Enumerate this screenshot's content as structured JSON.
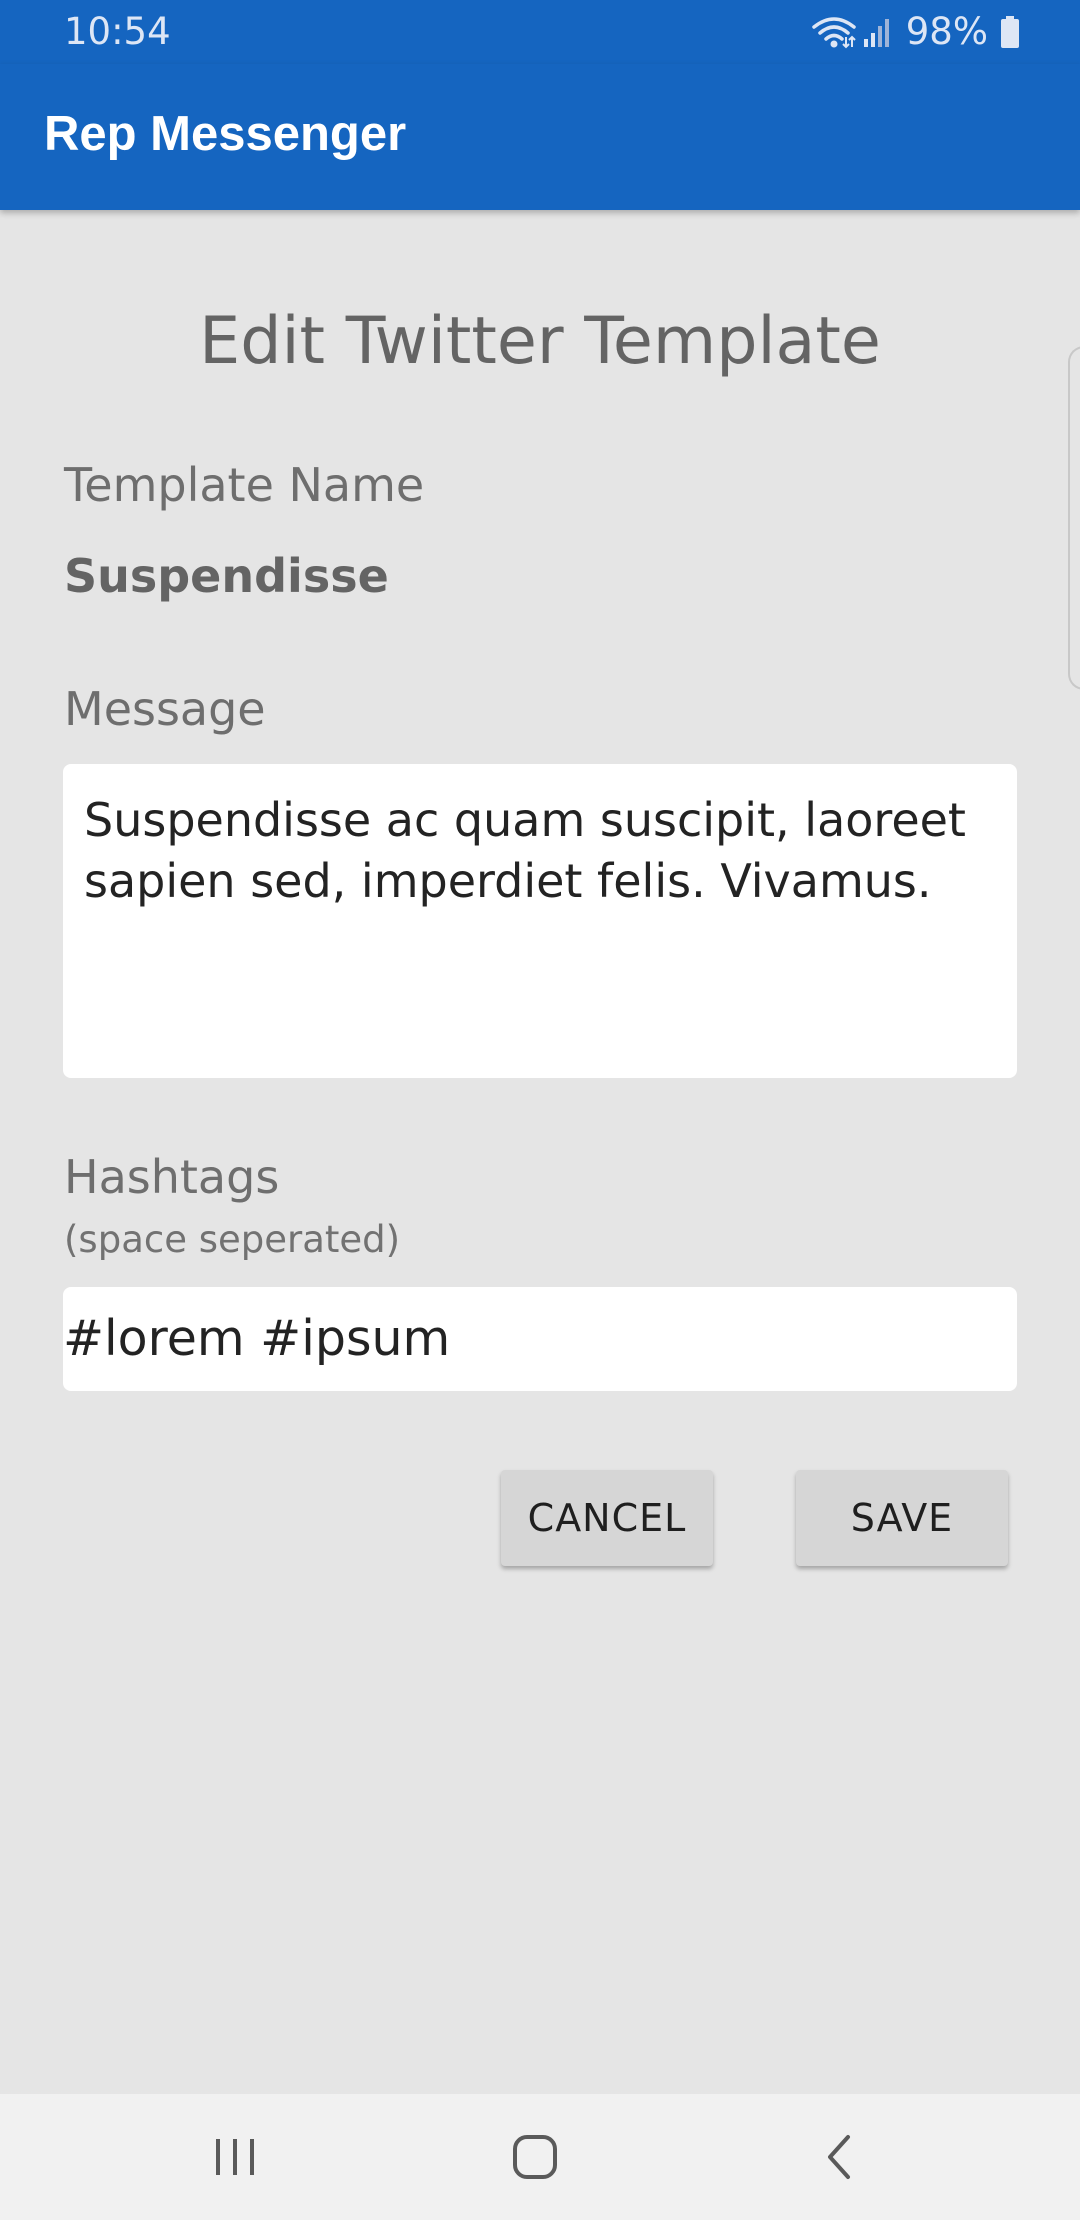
{
  "status_bar": {
    "time": "10:54",
    "battery": "98%",
    "icons": [
      "wifi-icon",
      "signal-icon",
      "battery-icon"
    ]
  },
  "app_bar": {
    "title": "Rep Messenger",
    "color": "#1565c0"
  },
  "form": {
    "title": "Edit Twitter Template",
    "template_name_label": "Template Name",
    "template_name_value": "Suspendisse",
    "message_label": "Message",
    "message_value": "Suspendisse ac quam suscipit, laoreet sapien sed, imperdiet felis. Vivamus.",
    "hashtags_label": "Hashtags",
    "hashtags_hint": "(space seperated)",
    "hashtags_value": "#lorem #ipsum",
    "cancel_label": "CANCEL",
    "save_label": "SAVE"
  },
  "nav_bar": {
    "icons": [
      "recent-apps-icon",
      "home-icon",
      "back-icon"
    ]
  }
}
